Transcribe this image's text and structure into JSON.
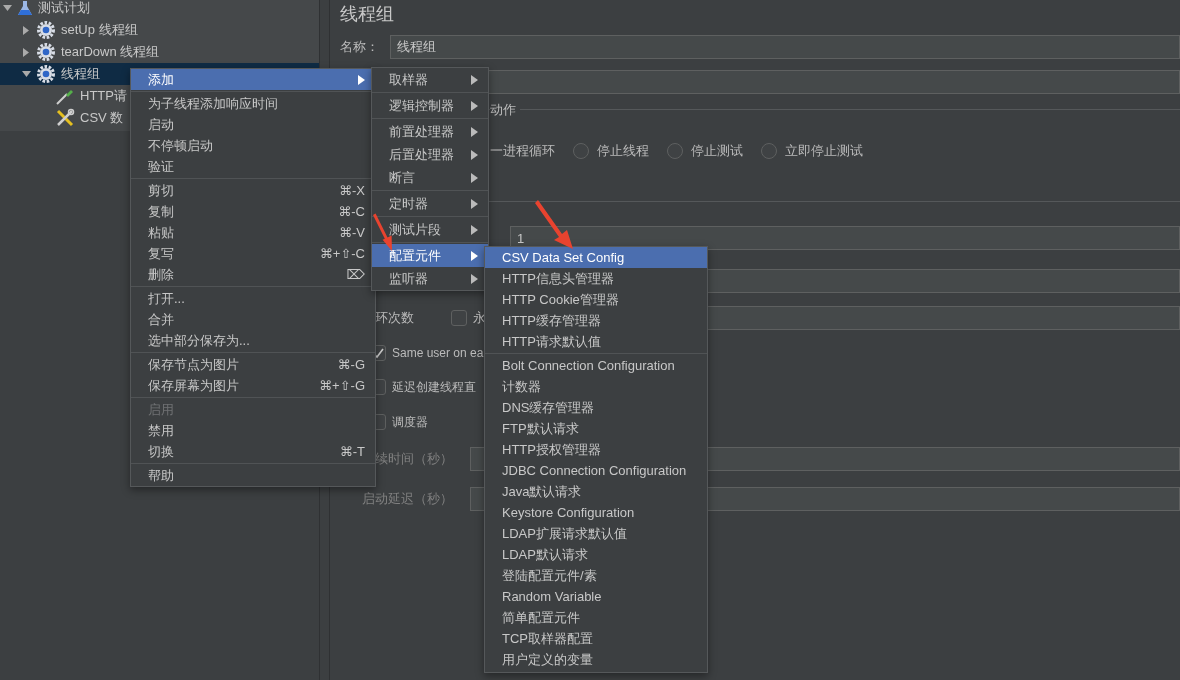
{
  "tree": {
    "label": "测试计划",
    "kind": "plan",
    "expanded": true,
    "selected": false,
    "children": [
      {
        "label": "setUp 线程组",
        "kind": "thread_group",
        "expanded": false,
        "selected": false
      },
      {
        "label": "tearDown 线程组",
        "kind": "thread_group",
        "expanded": false,
        "selected": false
      },
      {
        "label": "线程组",
        "kind": "thread_group",
        "expanded": true,
        "selected": true,
        "children": [
          {
            "label": "HTTP请",
            "kind": "sampler",
            "selected": false
          },
          {
            "label": "CSV 数",
            "kind": "config",
            "selected": false
          }
        ]
      }
    ]
  },
  "panel": {
    "title": "线程组",
    "name_label": "名称：",
    "name_value": "线程组",
    "action_legend": "动作",
    "action_partial": "一进程循环",
    "actions": [
      {
        "label": "停止线程",
        "selected": false
      },
      {
        "label": "停止测试",
        "selected": false
      },
      {
        "label": "立即停止测试",
        "selected": false
      }
    ],
    "thread_value": "1",
    "loop_label": "环次数",
    "forever": {
      "label": "永",
      "checked": false
    },
    "options": [
      {
        "label": "Same user on ea",
        "checked": true
      },
      {
        "label": "延迟创建线程直",
        "checked": false
      },
      {
        "label": "调度器",
        "checked": false
      }
    ],
    "scheduler_fields": [
      {
        "label": "续时间（秒）",
        "disabled": true
      },
      {
        "label": "启动延迟（秒）",
        "disabled": true
      }
    ]
  },
  "context_menu": {
    "groups": [
      [
        {
          "label": "添加",
          "submenu": true,
          "selected": true,
          "disabled": false
        }
      ],
      [
        {
          "label": "为子线程添加响应时间",
          "submenu": false,
          "selected": false,
          "disabled": false
        },
        {
          "label": "启动",
          "submenu": false,
          "selected": false,
          "disabled": false
        },
        {
          "label": "不停顿启动",
          "submenu": false,
          "selected": false,
          "disabled": false
        },
        {
          "label": "验证",
          "submenu": false,
          "selected": false,
          "disabled": false
        }
      ],
      [
        {
          "label": "剪切",
          "shortcut": "⌘-X",
          "submenu": false,
          "selected": false,
          "disabled": false
        },
        {
          "label": "复制",
          "shortcut": "⌘-C",
          "submenu": false,
          "selected": false,
          "disabled": false
        },
        {
          "label": "粘贴",
          "shortcut": "⌘-V",
          "submenu": false,
          "selected": false,
          "disabled": false
        },
        {
          "label": "复写",
          "shortcut": "⌘+⇧-C",
          "submenu": false,
          "selected": false,
          "disabled": false
        },
        {
          "label": "删除",
          "shortcut": "⌦",
          "submenu": false,
          "selected": false,
          "disabled": false
        }
      ],
      [
        {
          "label": "打开...",
          "submenu": false,
          "selected": false,
          "disabled": false
        },
        {
          "label": "合并",
          "submenu": false,
          "selected": false,
          "disabled": false
        },
        {
          "label": "选中部分保存为...",
          "submenu": false,
          "selected": false,
          "disabled": false
        }
      ],
      [
        {
          "label": "保存节点为图片",
          "shortcut": "⌘-G",
          "submenu": false,
          "selected": false,
          "disabled": false
        },
        {
          "label": "保存屏幕为图片",
          "shortcut": "⌘+⇧-G",
          "submenu": false,
          "selected": false,
          "disabled": false
        }
      ],
      [
        {
          "label": "启用",
          "submenu": false,
          "selected": false,
          "disabled": true
        },
        {
          "label": "禁用",
          "submenu": false,
          "selected": false,
          "disabled": false
        },
        {
          "label": "切换",
          "shortcut": "⌘-T",
          "submenu": false,
          "selected": false,
          "disabled": false
        }
      ],
      [
        {
          "label": "帮助",
          "submenu": false,
          "selected": false,
          "disabled": false
        }
      ]
    ]
  },
  "add_menu": {
    "groups": [
      [
        {
          "label": "取样器",
          "submenu": true,
          "selected": false
        }
      ],
      [
        {
          "label": "逻辑控制器",
          "submenu": true,
          "selected": false
        }
      ],
      [
        {
          "label": "前置处理器",
          "submenu": true,
          "selected": false
        },
        {
          "label": "后置处理器",
          "submenu": true,
          "selected": false
        },
        {
          "label": "断言",
          "submenu": true,
          "selected": false
        }
      ],
      [
        {
          "label": "定时器",
          "submenu": true,
          "selected": false
        }
      ],
      [
        {
          "label": "测试片段",
          "submenu": true,
          "selected": false
        }
      ],
      [
        {
          "label": "配置元件",
          "submenu": true,
          "selected": true
        },
        {
          "label": "监听器",
          "submenu": true,
          "selected": false
        }
      ]
    ]
  },
  "config_menu": {
    "groups": [
      [
        {
          "label": "CSV Data Set Config",
          "selected": true
        },
        {
          "label": "HTTP信息头管理器",
          "selected": false
        },
        {
          "label": "HTTP Cookie管理器",
          "selected": false
        },
        {
          "label": "HTTP缓存管理器",
          "selected": false
        },
        {
          "label": "HTTP请求默认值",
          "selected": false
        }
      ],
      [
        {
          "label": "Bolt Connection Configuration",
          "selected": false
        },
        {
          "label": "计数器",
          "selected": false
        },
        {
          "label": "DNS缓存管理器",
          "selected": false
        },
        {
          "label": "FTP默认请求",
          "selected": false
        },
        {
          "label": "HTTP授权管理器",
          "selected": false
        },
        {
          "label": "JDBC Connection Configuration",
          "selected": false
        },
        {
          "label": "Java默认请求",
          "selected": false
        },
        {
          "label": "Keystore Configuration",
          "selected": false
        },
        {
          "label": "LDAP扩展请求默认值",
          "selected": false
        },
        {
          "label": "LDAP默认请求",
          "selected": false
        },
        {
          "label": "登陆配置元件/素",
          "selected": false
        },
        {
          "label": "Random Variable",
          "selected": false
        },
        {
          "label": "简单配置元件",
          "selected": false
        },
        {
          "label": "TCP取样器配置",
          "selected": false
        },
        {
          "label": "用户定义的变量",
          "selected": false
        }
      ]
    ]
  }
}
